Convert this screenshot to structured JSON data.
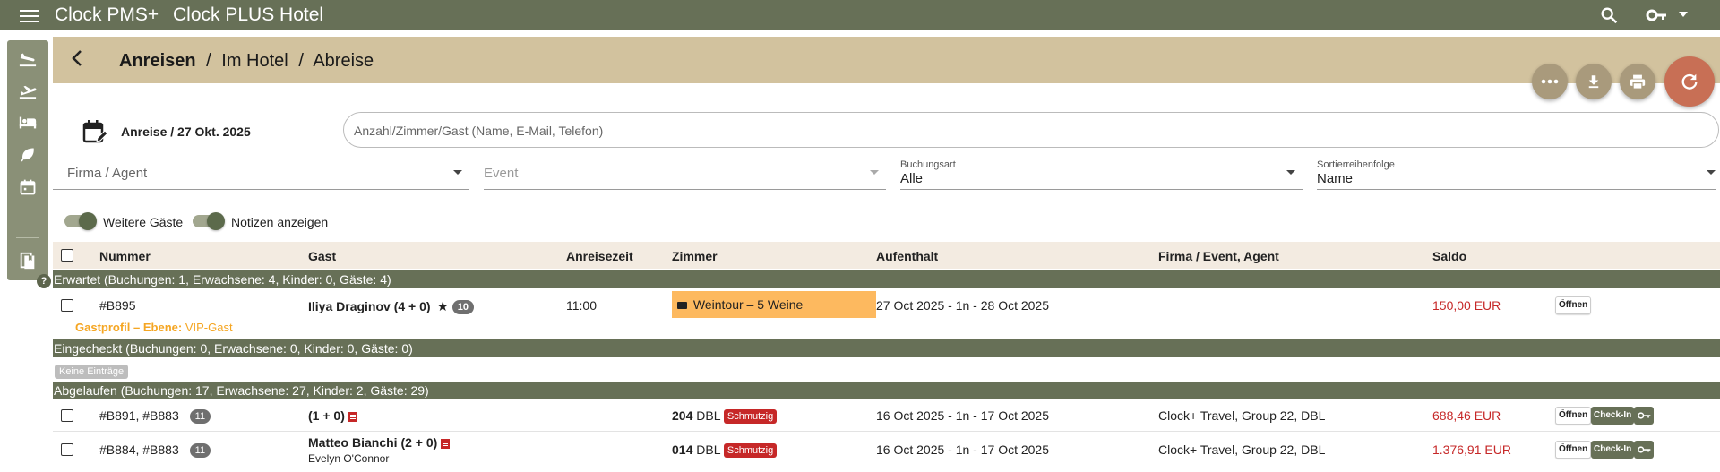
{
  "app": {
    "name": "Clock PMS+",
    "hotel": "Clock PLUS Hotel"
  },
  "topbar": {
    "menu_icon": "menu-icon",
    "search_icon": "search-icon",
    "key_icon": "key-icon"
  },
  "sidebar": {
    "items": [
      {
        "icon": "arrivals-icon"
      },
      {
        "icon": "departures-icon"
      },
      {
        "icon": "bed-icon"
      },
      {
        "icon": "leaf-icon"
      },
      {
        "icon": "calendar-icon"
      },
      {
        "icon": "book-icon"
      }
    ],
    "help": "?"
  },
  "breadcrumb": {
    "active": "Anreisen",
    "sep": "/",
    "item2": "Im Hotel",
    "item3": "Abreise"
  },
  "actions": [
    "more-icon",
    "download-icon",
    "print-icon",
    "refresh-icon"
  ],
  "filters": {
    "date_label": "Anreise / 27 Okt. 2025",
    "search_placeholder": "Anzahl/Zimmer/Gast (Name, E-Mail, Telefon)",
    "company_label": "Firma / Agent",
    "event_label": "Event",
    "booking_type_label": "Buchungsart",
    "booking_type_value": "Alle",
    "sort_label": "Sortierreihenfolge",
    "sort_value": "Name",
    "toggle_guests": "Weitere Gäste",
    "toggle_notes": "Notizen anzeigen"
  },
  "table": {
    "headers": {
      "number": "Nummer",
      "guest": "Gast",
      "arrival_time": "Anreisezeit",
      "room": "Zimmer",
      "stay": "Aufenthalt",
      "company": "Firma / Event, Agent",
      "balance": "Saldo"
    },
    "groups": {
      "expected": "Erwartet (Buchungen: 1, Erwachsene: 4, Kinder: 0, Gäste: 4)",
      "checked_in": "Eingecheckt (Buchungen: 0, Erwachsene: 0, Kinder: 0, Gäste: 0)",
      "expired": "Abgelaufen (Buchungen: 17, Erwachsene: 27, Kinder: 2, Gäste: 29)"
    },
    "no_entries": "Keine Einträge",
    "row1": {
      "number": "#B895",
      "guest": "Iliya Draginov (4 + 0)",
      "guest_count": "10",
      "arrival_time": "11:00",
      "event": "Weintour – 5 Weine",
      "stay": "27 Oct 2025 - 1n - 28 Oct 2025",
      "balance": "150,00 EUR",
      "open": "Öffnen",
      "profile_label": "Gastprofil – Ebene:",
      "profile_value": "VIP-Gast"
    },
    "row2": {
      "number": "#B891, #B883",
      "count": "11",
      "guest": "(1 + 0)",
      "room_no": "204",
      "room_type": "DBL",
      "status": "Schmutzig",
      "stay": "16 Oct 2025 - 1n - 17 Oct 2025",
      "company": "Clock+ Travel, Group 22, DBL",
      "balance": "688,46 EUR",
      "open": "Öffnen",
      "checkin": "Check-In"
    },
    "row3": {
      "number": "#B884, #B883",
      "count": "11",
      "guest": "Matteo Bianchi (2 + 0)",
      "guest2": "Evelyn O'Connor",
      "room_no": "014",
      "room_type": "DBL",
      "status": "Schmutzig",
      "stay": "16 Oct 2025 - 1n - 17 Oct 2025",
      "company": "Clock+ Travel, Group 22, DBL",
      "balance": "1.376,91 EUR",
      "open": "Öffnen",
      "checkin": "Check-In"
    }
  },
  "colors": {
    "primary": "#677057",
    "title_bar": "#d2c29e",
    "refresh": "#c86f55",
    "event": "#fdb95f",
    "negative": "#c62828",
    "vip": "#f5a623"
  }
}
